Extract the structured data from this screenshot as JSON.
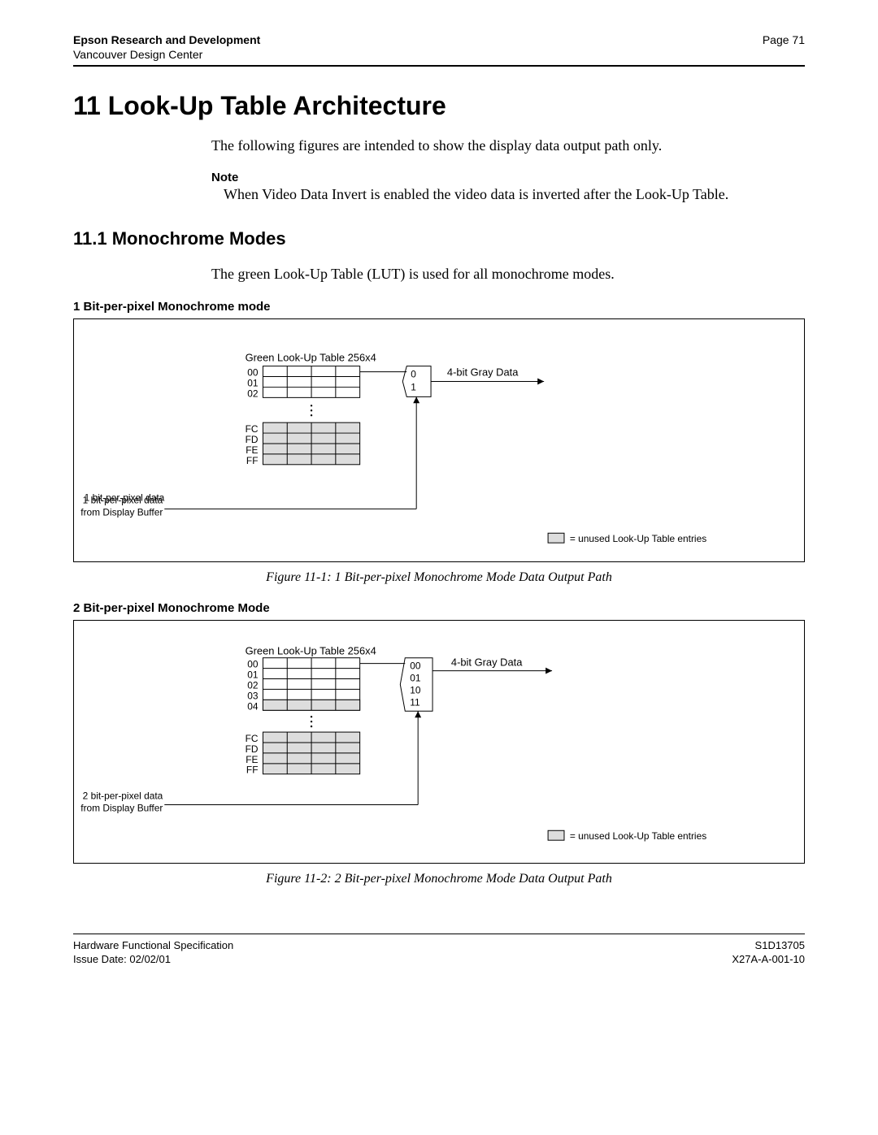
{
  "header": {
    "org": "Epson Research and Development",
    "dept": "Vancouver Design Center",
    "page": "Page 71"
  },
  "titles": {
    "h1": "11  Look-Up Table Architecture",
    "intro": "The following figures are intended to show the display data output path only.",
    "note_label": "Note",
    "note_body": "When Video Data Invert is enabled the video data is inverted after the Look-Up Table.",
    "h2": "11.1  Monochrome Modes",
    "h2_body": "The green Look-Up Table (LUT) is used for all monochrome modes."
  },
  "fig1": {
    "subhead": "1 Bit-per-pixel Monochrome mode",
    "lut_title": "Green Look-Up Table 256x4",
    "rows_top": [
      "00",
      "01",
      "02"
    ],
    "rows_bot": [
      "FC",
      "FD",
      "FE",
      "FF"
    ],
    "mux_labels": [
      "0",
      "1"
    ],
    "out_label": "4-bit Gray Data",
    "in_label1": "1 bit-per-pixel data",
    "in_label2": "from Display Buffer",
    "legend": "= unused Look-Up Table entries",
    "caption": "Figure 11-1: 1 Bit-per-pixel Monochrome Mode Data Output Path"
  },
  "fig2": {
    "subhead": "2 Bit-per-pixel Monochrome Mode",
    "lut_title": "Green Look-Up Table 256x4",
    "rows_top": [
      "00",
      "01",
      "02",
      "03",
      "04"
    ],
    "rows_bot": [
      "FC",
      "FD",
      "FE",
      "FF"
    ],
    "mux_labels": [
      "00",
      "01",
      "10",
      "11"
    ],
    "out_label": "4-bit Gray Data",
    "in_label1": "2 bit-per-pixel data",
    "in_label2": "from Display Buffer",
    "legend": "= unused Look-Up Table entries",
    "caption": "Figure 11-2: 2 Bit-per-pixel Monochrome Mode Data Output Path"
  },
  "footer": {
    "left1": "Hardware Functional Specification",
    "left2": "Issue Date: 02/02/01",
    "right1": "S1D13705",
    "right2": "X27A-A-001-10"
  }
}
